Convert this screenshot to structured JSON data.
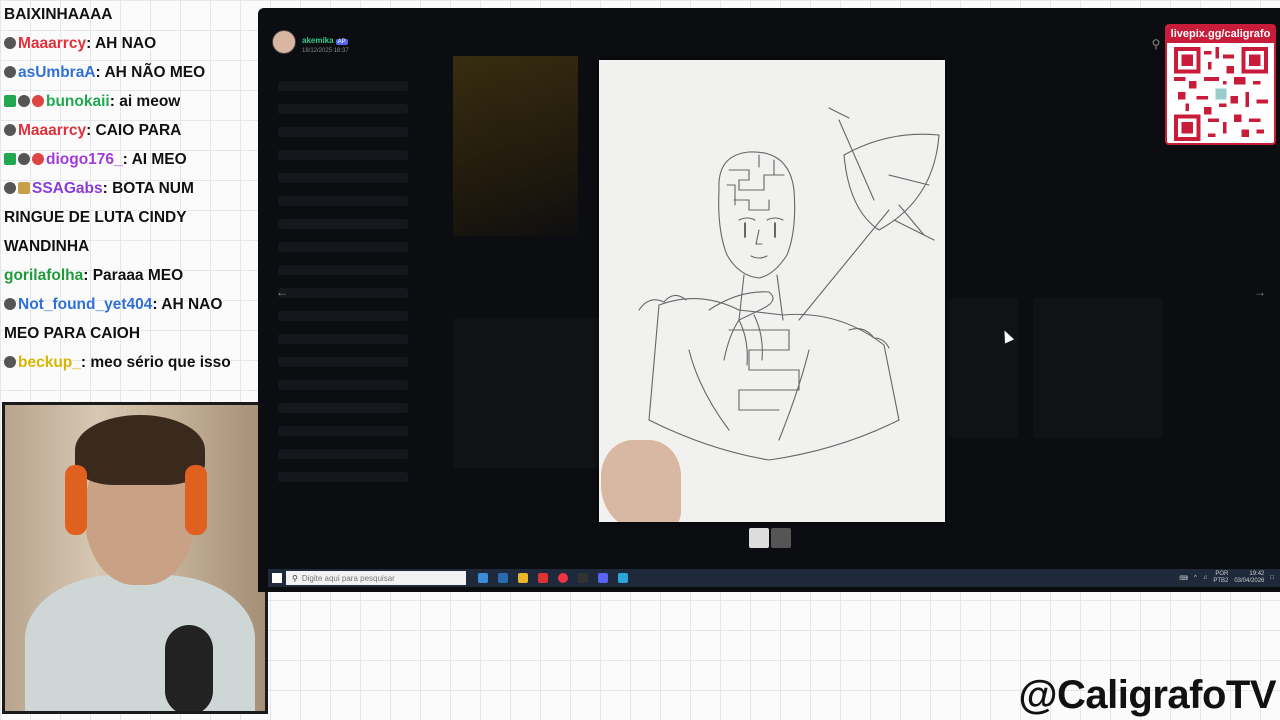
{
  "chat": [
    {
      "badges": [],
      "user": "",
      "user_color": "#111111",
      "message": "BAIXINHAAAA"
    },
    {
      "badges": [
        "mod"
      ],
      "user": "Maaarrcy",
      "user_color": "#e0303a",
      "message": "AH NAO"
    },
    {
      "badges": [
        "mod"
      ],
      "user": "asUmbraA",
      "user_color": "#2f6fd8",
      "message": "AH NÃO MEO"
    },
    {
      "badges": [
        "green",
        "mod",
        "red"
      ],
      "user": "bunokaii",
      "user_color": "#1fa84f",
      "message": "ai meow"
    },
    {
      "badges": [
        "mod"
      ],
      "user": "Maaarrcy",
      "user_color": "#e0303a",
      "message": "CAIO PARA"
    },
    {
      "badges": [
        "green",
        "mod",
        "red"
      ],
      "user": "diogo176_",
      "user_color": "#a13ad8",
      "message": "AI MEO"
    },
    {
      "badges": [
        "mod",
        "gift"
      ],
      "user": "SSAGabs",
      "user_color": "#8a3ad8",
      "message": "BOTA NUM RINGUE DE LUTA CINDY"
    },
    {
      "badges": [],
      "user": "",
      "user_color": "#111111",
      "message": "WANDINHA"
    },
    {
      "badges": [],
      "user": "gorilafolha",
      "user_color": "#1e9a3a",
      "message": "Paraaa MEO"
    },
    {
      "badges": [
        "bot"
      ],
      "user": "Not_found_yet404",
      "user_color": "#2f6fd8",
      "message": "AH NAO MEO PARA CAIOH"
    },
    {
      "badges": [
        "mod"
      ],
      "user": "beckup_",
      "user_color": "#d8b400",
      "message": "meo sério que isso"
    }
  ],
  "viewer": {
    "uploader_name": "akemika",
    "uploader_tag": "AP",
    "uploader_date": "18/12/2025 18:37",
    "prev_icon": "chevron-left-icon",
    "next_icon": "chevron-right-icon",
    "zoom_icon": "zoom-icon"
  },
  "taskbar": {
    "search_placeholder": "Digite aqui para pesquisar",
    "lang": "POR",
    "lang_sub": "PTB2",
    "time": "19:42",
    "date": "03/04/2026"
  },
  "qr": {
    "url": "livepix.gg/caligrafo"
  },
  "handle": "@CaligrafoTV",
  "colors": {
    "qr_border": "#c91c3a",
    "screen_bg": "#0c0d10",
    "discord_blurple": "#5865f2"
  }
}
